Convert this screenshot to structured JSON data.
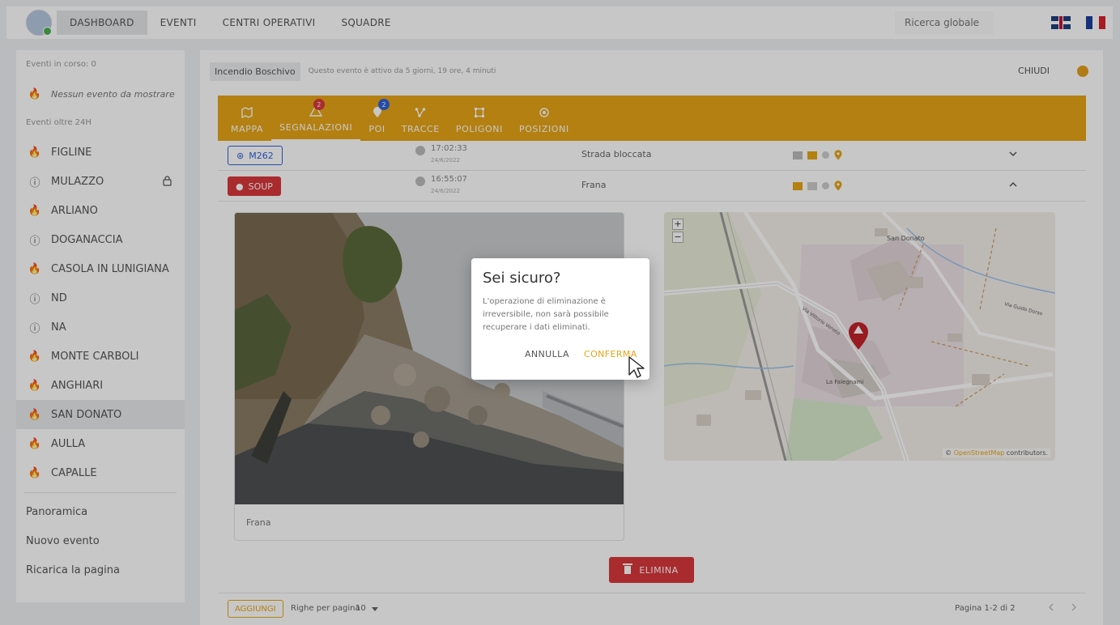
{
  "topnav": {
    "items": [
      "DASHBOARD",
      "EVENTI",
      "CENTRI OPERATIVI",
      "SQUADRE"
    ],
    "active": "DASHBOARD",
    "search_placeholder": "Ricerca globale",
    "languages": [
      "uk-flag-icon",
      "fr-flag-icon"
    ]
  },
  "sidebar": {
    "section_current": "Eventi in corso: 0",
    "no_event": "Nessun evento da mostrare",
    "section_over24": "Eventi oltre 24H",
    "items": [
      {
        "label": "FIGLINE",
        "icon": "fire-icon"
      },
      {
        "label": "MULAZZO",
        "icon": "alert-icon",
        "locked": true
      },
      {
        "label": "ARLIANO",
        "icon": "fire-icon"
      },
      {
        "label": "DOGANACCIA",
        "icon": "alert-icon"
      },
      {
        "label": "CASOLA IN LUNIGIANA",
        "icon": "fire-icon"
      },
      {
        "label": "ND",
        "icon": "alert-icon"
      },
      {
        "label": "NA",
        "icon": "alert-icon"
      },
      {
        "label": "MONTE CARBOLI",
        "icon": "fire-icon"
      },
      {
        "label": "ANGHIARI",
        "icon": "fire-icon"
      },
      {
        "label": "SAN DONATO",
        "icon": "fire-icon",
        "selected": true
      },
      {
        "label": "AULLA",
        "icon": "fire-icon"
      },
      {
        "label": "CAPALLE",
        "icon": "fire-icon"
      }
    ],
    "links": [
      "Panoramica",
      "Nuovo evento",
      "Ricarica la pagina"
    ]
  },
  "event": {
    "name": "Incendio Boschivo",
    "info": "Questo evento è attivo da 5 giorni, 19 ore, 4 minuti",
    "close_label": "CHIUDI",
    "status_color": "#e39f1b"
  },
  "tabs": [
    {
      "label": "MAPPA",
      "icon": "map-icon"
    },
    {
      "label": "SEGNALAZIONI",
      "icon": "warning-icon",
      "badge": "2",
      "active": true
    },
    {
      "label": "POI",
      "icon": "poi-icon",
      "badge": "2"
    },
    {
      "label": "TRACCE",
      "icon": "tracks-icon"
    },
    {
      "label": "POLIGONI",
      "icon": "polygon-icon"
    },
    {
      "label": "POSIZIONI",
      "icon": "position-icon"
    }
  ],
  "reports": [
    {
      "source": "M262",
      "time": "17:02:33",
      "date": "24/6/2022",
      "type": "Strada bloccata",
      "expanded": false
    },
    {
      "source": "SOUP",
      "time": "16:55:07",
      "date": "24/6/2022",
      "type": "Frana",
      "expanded": true
    }
  ],
  "detail": {
    "caption": "Frana",
    "delete_label": "ELIMINA",
    "map": {
      "zoom_in": "+",
      "zoom_out": "−",
      "attribution_prefix": "©",
      "attribution_link": "OpenStreetMap",
      "attribution_suffix": "contributors.",
      "labels": [
        "San Donato",
        "La Falegnami",
        "Via Guido Dorso",
        "Via Vittorio Veneto"
      ]
    }
  },
  "footer": {
    "add_label": "AGGIUNGI",
    "rows_per_page_label": "Righe per pagina",
    "rows_per_page_value": "10",
    "page_info": "Pagina 1-2 di 2"
  },
  "dialog": {
    "title": "Sei sicuro?",
    "body": "L'operazione di eliminazione è irreversibile, non sarà possibile recuperare i dati eliminati.",
    "cancel": "ANNULLA",
    "confirm": "CONFERMA"
  },
  "colors": {
    "accent": "#e6a417",
    "danger": "#d9383c",
    "primary": "#2f62d9"
  }
}
